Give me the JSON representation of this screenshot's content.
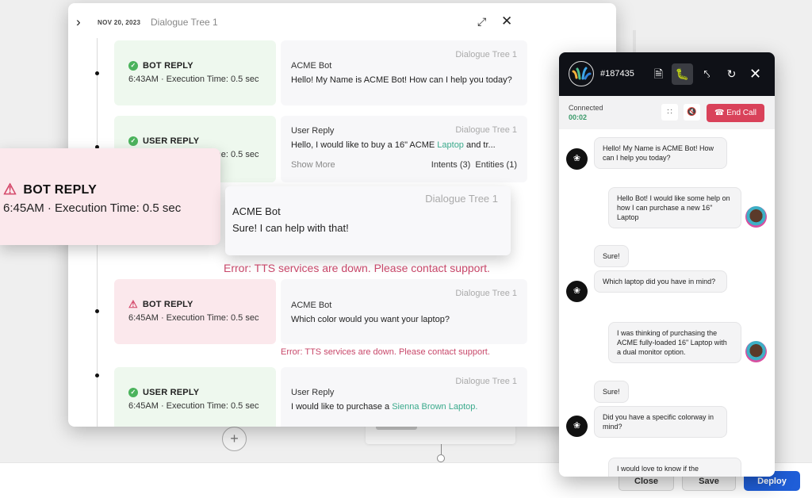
{
  "modal": {
    "date": "NOV 20, 2023",
    "title": "Dialogue Tree 1",
    "entries": [
      {
        "status": "ok",
        "label": "BOT REPLY",
        "time": "6:43AM · Execution Time: 0.5 sec",
        "tree": "Dialogue Tree 1",
        "sender": "ACME Bot",
        "text": "Hello! My Name is ACME Bot! How can I help you today?"
      },
      {
        "status": "ok",
        "label": "USER REPLY",
        "time": "6:45AM · Execution Time: 0.5 sec",
        "tree": "Dialogue Tree 1",
        "sender": "User Reply",
        "text_pre": "Hello, I would like to buy a 16\" ACME ",
        "text_hl": "Laptop",
        "text_post": " and tr...",
        "show_more": "Show More",
        "intents": "Intents (3)",
        "entities": "Entities (1)"
      },
      {
        "status": "error",
        "label": "BOT REPLY",
        "time": "6:45AM · Execution Time: 0.5 sec",
        "tree": "Dialogue Tree 1",
        "sender": "ACME Bot",
        "text": "Which color would you want your laptop?",
        "error": "Error: TTS services are down. Please contact support."
      },
      {
        "status": "ok",
        "label": "USER REPLY",
        "time": "6:45AM · Execution Time: 0.5 sec",
        "tree": "Dialogue Tree 1",
        "sender": "User Reply",
        "text_pre": "I would like to purchase a ",
        "text_hl": "Sienna Brown Laptop."
      }
    ]
  },
  "highlight": {
    "status_label": "BOT REPLY",
    "status_time": "6:45AM · Execution Time: 0.5 sec",
    "tree": "Dialogue Tree 1",
    "sender": "ACME Bot",
    "text": "Sure! I can help with that!",
    "error": "Error: TTS services are down. Please contact support."
  },
  "widget": {
    "ticket": "#187435",
    "status": "Connected",
    "timer": "00:02",
    "end_call": "End Call",
    "messages": [
      {
        "from": "bot",
        "text": "Hello! My Name is ACME Bot! How can I help you today?"
      },
      {
        "from": "user",
        "text": "Hello Bot! I would like some help on how I can purchase a new 16\" Laptop"
      },
      {
        "from": "bot",
        "text": "Sure!"
      },
      {
        "from": "bot",
        "text": "Which laptop did you have in mind?"
      },
      {
        "from": "user",
        "text": "I was thinking of purchasing the ACME fully-loaded 16\" Laptop with a dual monitor option."
      },
      {
        "from": "bot",
        "text": "Sure!"
      },
      {
        "from": "bot",
        "text": "Did you have a specific colorway in mind?"
      },
      {
        "from": "user",
        "text": "I would love to know if the"
      }
    ]
  },
  "footer": {
    "close": "Close",
    "save": "Save",
    "deploy": "Deploy"
  },
  "colors": {
    "success": "#4bb35c",
    "error": "#c8486a",
    "link": "#3aaa8c",
    "deploy": "#1f5ed8",
    "end_call": "#d9425a"
  }
}
